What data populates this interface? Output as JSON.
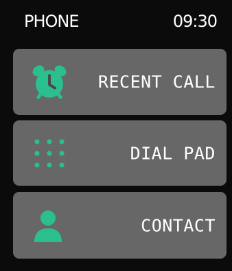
{
  "status_bar": {
    "title": "PHONE",
    "time": "09:30"
  },
  "menu": {
    "items": [
      {
        "label": "RECENT CALL",
        "icon": "alarm-clock-icon"
      },
      {
        "label": "DIAL PAD",
        "icon": "dial-pad-icon"
      },
      {
        "label": "CONTACT",
        "icon": "contact-person-icon"
      }
    ]
  },
  "colors": {
    "background": "#0b0b0b",
    "card": "#676767",
    "accent": "#2bbf8f",
    "text": "#ffffff"
  }
}
